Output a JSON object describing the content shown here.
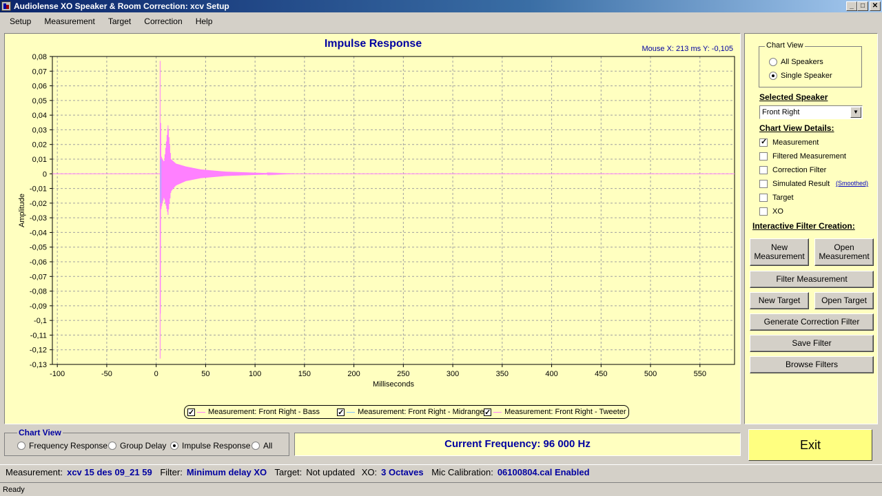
{
  "window": {
    "title": "Audiolense XO Speaker & Room Correction: xcv Setup"
  },
  "menu": [
    "Setup",
    "Measurement",
    "Target",
    "Correction",
    "Help"
  ],
  "chart": {
    "title": "Impulse Response",
    "mouse_readout": "Mouse X: 213 ms   Y: -0,105",
    "legend": [
      {
        "label": "Measurement: Front Right - Bass",
        "checked": true,
        "color": "#ff80ff"
      },
      {
        "label": "Measurement: Front Right - Midrange",
        "checked": true,
        "color": "#80c0ff"
      },
      {
        "label": "Measurement: Front Right - Tweeter",
        "checked": true,
        "color": "#ff80ff"
      }
    ]
  },
  "chart_data": {
    "type": "line",
    "title": "Impulse Response",
    "xlabel": "Milliseconds",
    "ylabel": "Amplitude",
    "xlim": [
      -105,
      585
    ],
    "ylim": [
      -0.13,
      0.08
    ],
    "x_ticks": [
      "-100",
      "-50",
      "0",
      "50",
      "100",
      "150",
      "200",
      "250",
      "300",
      "350",
      "400",
      "450",
      "500",
      "550"
    ],
    "y_ticks": [
      "0,08",
      "0,07",
      "0,06",
      "0,05",
      "0,04",
      "0,03",
      "0,02",
      "0,01",
      "0",
      "-0,01",
      "-0,02",
      "-0,03",
      "-0,04",
      "-0,05",
      "-0,06",
      "-0,07",
      "-0,08",
      "-0,09",
      "-0,1",
      "-0,11",
      "-0,12",
      "-0,13"
    ],
    "grid": true,
    "series": [
      {
        "name": "Measurement: Front Right - Bass",
        "color": "#ff80ff",
        "peaks": [
          {
            "x": 4,
            "max": 0.077,
            "min": -0.126
          },
          {
            "x": 5,
            "max": 0.012,
            "min": -0.024
          },
          {
            "x": 8,
            "max": 0.008,
            "min": -0.016
          },
          {
            "x": 12,
            "max": 0.033,
            "min": -0.028
          },
          {
            "x": 15,
            "max": 0.01,
            "min": -0.012
          },
          {
            "x": 20,
            "max": 0.007,
            "min": -0.008
          },
          {
            "x": 30,
            "max": 0.005,
            "min": -0.005
          },
          {
            "x": 45,
            "max": 0.003,
            "min": -0.003
          },
          {
            "x": 70,
            "max": 0.0015,
            "min": -0.0015
          },
          {
            "x": 110,
            "max": 0.0005,
            "min": -0.0005
          },
          {
            "x": 140,
            "max": 0.0,
            "min": 0.0
          }
        ]
      }
    ]
  },
  "right_panel": {
    "chart_view_group": "Chart View",
    "chart_view_options": [
      "All Speakers",
      "Single Speaker"
    ],
    "chart_view_selected": 1,
    "selected_speaker_heading": "Selected Speaker",
    "selected_speaker": "Front Right",
    "details_heading": "Chart View Details:",
    "details": [
      {
        "label": "Measurement",
        "checked": true
      },
      {
        "label": "Filtered Measurement",
        "checked": false
      },
      {
        "label": "Correction Filter",
        "checked": false
      },
      {
        "label": "Simulated Result",
        "checked": false
      },
      {
        "label": "Target",
        "checked": false
      },
      {
        "label": "XO",
        "checked": false
      }
    ],
    "smoothed_link": "(Smoothed)",
    "interactive_heading": "Interactive Filter Creation:",
    "buttons": {
      "new_measurement": "New Measurement",
      "open_measurement": "Open Measurement",
      "filter_measurement": "Filter Measurement",
      "new_target": "New Target",
      "open_target": "Open Target",
      "generate_correction": "Generate Correction Filter",
      "save_filter": "Save Filter",
      "browse_filters": "Browse Filters"
    }
  },
  "bottom": {
    "chart_view_label": "Chart View",
    "view_options": [
      "Frequency Response",
      "Group Delay",
      "Impulse Response",
      "All"
    ],
    "view_selected": 2,
    "current_frequency": "Current Frequency: 96 000 Hz",
    "exit_label": "Exit"
  },
  "info": {
    "measurement_label": "Measurement:",
    "measurement_value": "xcv 15 des 09_21 59",
    "filter_label": "Filter:",
    "filter_value": "Minimum delay XO",
    "target_label": "Target:",
    "target_value": "Not updated",
    "xo_label": "XO:",
    "xo_value": "3 Octaves",
    "mic_label": "Mic Calibration:",
    "mic_value": "06100804.cal Enabled"
  },
  "status": "Ready"
}
